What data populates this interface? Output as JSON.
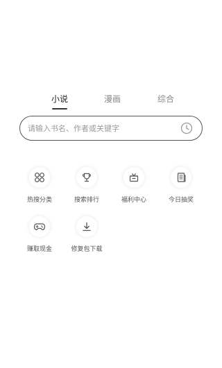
{
  "tabs": [
    {
      "label": "小说",
      "active": true
    },
    {
      "label": "漫画",
      "active": false
    },
    {
      "label": "综合",
      "active": false
    }
  ],
  "search": {
    "placeholder": "请输入书名、作者或关键字",
    "value": "",
    "history_icon": "history-clock-icon"
  },
  "shortcuts": [
    {
      "label": "热搜分类",
      "icon": "category-grid-icon"
    },
    {
      "label": "搜索排行",
      "icon": "trophy-icon"
    },
    {
      "label": "福利中心",
      "icon": "gift-icon"
    },
    {
      "label": "今日抽奖",
      "icon": "news-icon"
    },
    {
      "label": "赚取现金",
      "icon": "gamepad-icon"
    },
    {
      "label": "修复包下载",
      "icon": "download-icon"
    }
  ],
  "colors": {
    "text_active": "#222222",
    "text_inactive": "#8a8a8a",
    "border": "#555555",
    "icon_stroke": "#555555"
  }
}
